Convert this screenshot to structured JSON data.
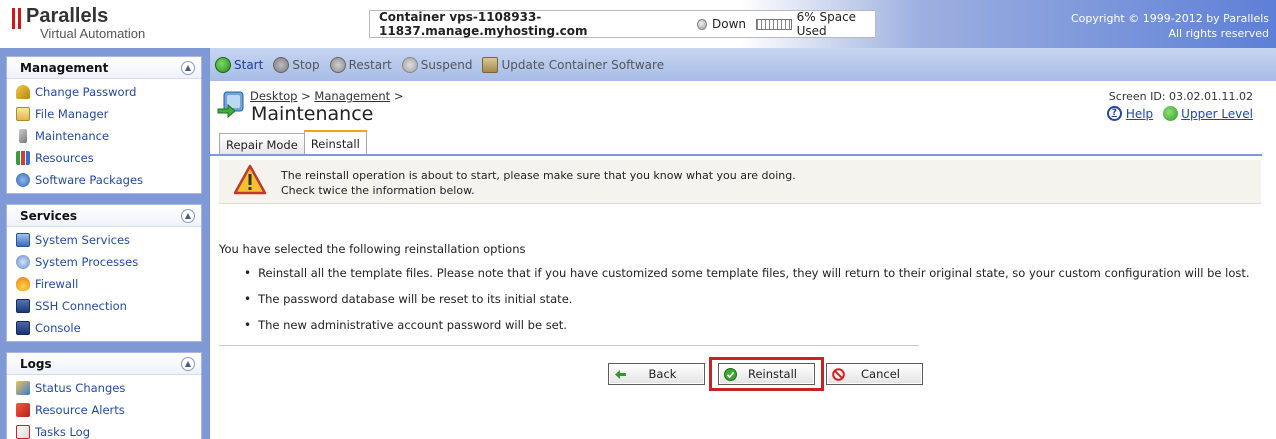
{
  "header": {
    "brand": "Parallels",
    "subtitle": "Virtual Automation",
    "container_label": "Container vps-1108933-11837.manage.myhosting.com",
    "container_status": "Down",
    "space_used": "6% Space Used",
    "copyright_line1": "Copyright © 1999-2012 by Parallels",
    "copyright_line2": "All rights reserved"
  },
  "sidebar": {
    "management": {
      "title": "Management",
      "items": [
        {
          "label": "Change Password",
          "icon": "key-icon"
        },
        {
          "label": "File Manager",
          "icon": "file-manager-icon"
        },
        {
          "label": "Maintenance",
          "icon": "maintenance-icon"
        },
        {
          "label": "Resources",
          "icon": "resources-chart-icon"
        },
        {
          "label": "Software Packages",
          "icon": "packages-icon"
        }
      ]
    },
    "services": {
      "title": "Services",
      "items": [
        {
          "label": "System Services",
          "icon": "system-services-icon"
        },
        {
          "label": "System Processes",
          "icon": "system-processes-icon"
        },
        {
          "label": "Firewall",
          "icon": "firewall-icon"
        },
        {
          "label": "SSH Connection",
          "icon": "ssh-icon"
        },
        {
          "label": "Console",
          "icon": "console-icon"
        }
      ]
    },
    "logs": {
      "title": "Logs",
      "items": [
        {
          "label": "Status Changes",
          "icon": "status-changes-icon"
        },
        {
          "label": "Resource Alerts",
          "icon": "resource-alerts-icon"
        },
        {
          "label": "Tasks Log",
          "icon": "tasks-log-icon"
        }
      ]
    }
  },
  "toolbar": {
    "start": "Start",
    "stop": "Stop",
    "restart": "Restart",
    "suspend": "Suspend",
    "update": "Update Container Software"
  },
  "page": {
    "breadcrumb_desktop": "Desktop",
    "breadcrumb_management": "Management",
    "breadcrumb_sep": ">",
    "title": "Maintenance",
    "screen_id": "Screen ID: 03.02.01.11.02",
    "help": "Help",
    "upper_level": "Upper Level"
  },
  "tabs": {
    "repair_mode": "Repair Mode",
    "reinstall": "Reinstall"
  },
  "warning": {
    "line1": "The reinstall operation is about to start, please make sure that you know what you are doing.",
    "line2": "Check twice the information below."
  },
  "content": {
    "intro": "You have selected the following reinstallation options",
    "bullets": [
      "Reinstall all the template files. Please note that if you have customized some template files, they will return to their original state, so your custom configuration will be lost.",
      "The password database will be reset to its initial state.",
      "The new administrative account password will be set."
    ]
  },
  "buttons": {
    "back": "Back",
    "reinstall": "Reinstall",
    "cancel": "Cancel"
  },
  "colors": {
    "sidebar_bg": "#7f99d6",
    "link_blue": "#244a9e",
    "highlight_red": "#c42424",
    "tab_accent": "#f0a31b"
  }
}
